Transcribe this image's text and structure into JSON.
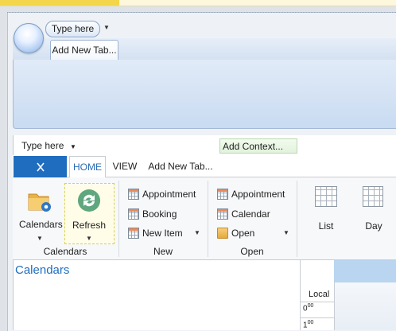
{
  "outer_window": {
    "qat_label": "Type here",
    "tab_label": "Add New Tab..."
  },
  "qat": {
    "label": "Type here"
  },
  "context_button": "Add Context...",
  "tabs": {
    "file_icon": "connection-icon",
    "home": "HOME",
    "view": "VIEW",
    "add_new": "Add New Tab..."
  },
  "groups": {
    "calendars": {
      "label": "Calendars",
      "calendars_btn": "Calendars",
      "refresh_btn": "Refresh"
    },
    "new": {
      "label": "New",
      "appointment": "Appointment",
      "booking": "Booking",
      "new_item": "New Item"
    },
    "open": {
      "label": "Open",
      "appointment": "Appointment",
      "calendar": "Calendar",
      "open": "Open"
    },
    "arrange": {
      "list": "List",
      "day": "Day"
    }
  },
  "left_pane": {
    "title": "Calendars"
  },
  "schedule": {
    "timezone_label": "Local",
    "times": [
      {
        "hour": "0",
        "minutes": "00"
      },
      {
        "hour": "1",
        "minutes": "00"
      }
    ]
  },
  "colors": {
    "accent": "#1f6dbf",
    "selected_day": "#b9d5ef",
    "context_green": "#e2f2dc"
  }
}
